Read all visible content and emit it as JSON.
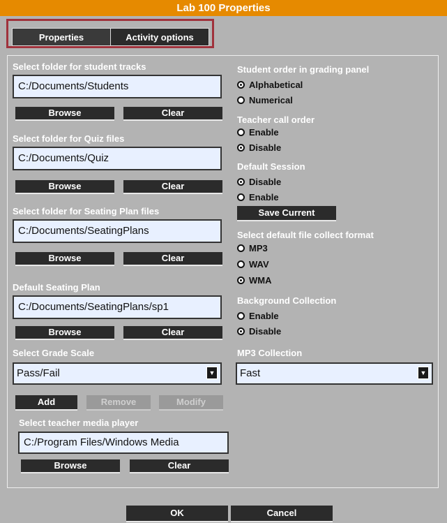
{
  "title": "Lab 100 Properties",
  "tabs": {
    "properties": "Properties",
    "activity_options": "Activity options"
  },
  "left": {
    "student_tracks": {
      "label": "Select folder for student tracks",
      "value": "C:/Documents/Students"
    },
    "quiz": {
      "label": "Select folder for Quiz files",
      "value": "C:/Documents/Quiz"
    },
    "seating_plan_files": {
      "label": "Select folder for Seating Plan files",
      "value": "C:/Documents/SeatingPlans"
    },
    "default_seating_plan": {
      "label": "Default Seating Plan",
      "value": "C:/Documents/SeatingPlans/sp1"
    },
    "grade_scale": {
      "label": "Select Grade Scale",
      "value": "Pass/Fail"
    },
    "media_player": {
      "label": "Select teacher media player",
      "value": "C:/Program Files/Windows Media"
    }
  },
  "buttons": {
    "browse": "Browse",
    "clear": "Clear",
    "add": "Add",
    "remove": "Remove",
    "modify": "Modify",
    "save_current": "Save Current",
    "ok": "OK",
    "cancel": "Cancel"
  },
  "right": {
    "student_order": {
      "label": "Student order in grading panel",
      "opt1": "Alphabetical",
      "opt2": "Numerical",
      "selected": "Alphabetical"
    },
    "teacher_call": {
      "label": "Teacher call order",
      "opt1": "Enable",
      "opt2": "Disable",
      "selected": "Disable"
    },
    "default_session": {
      "label": "Default Session",
      "opt1": "Disable",
      "opt2": "Enable",
      "selected": "Disable"
    },
    "collect_format": {
      "label": "Select default file collect format",
      "opt1": "MP3",
      "opt2": "WAV",
      "opt3": "WMA",
      "selected": "WMA"
    },
    "background_collection": {
      "label": "Background Collection",
      "opt1": "Enable",
      "opt2": "Disable",
      "selected": "Disable"
    },
    "mp3_collection": {
      "label": "MP3 Collection",
      "value": "Fast"
    }
  },
  "icons": {
    "dropdown": "chevron-down-icon",
    "radio": "radio-icon"
  },
  "colors": {
    "titlebar": "#e68a00",
    "background": "#b3b3b3",
    "button": "#2b2b2b",
    "tab_highlight": "#a0323c",
    "field": "#e8f0ff"
  }
}
